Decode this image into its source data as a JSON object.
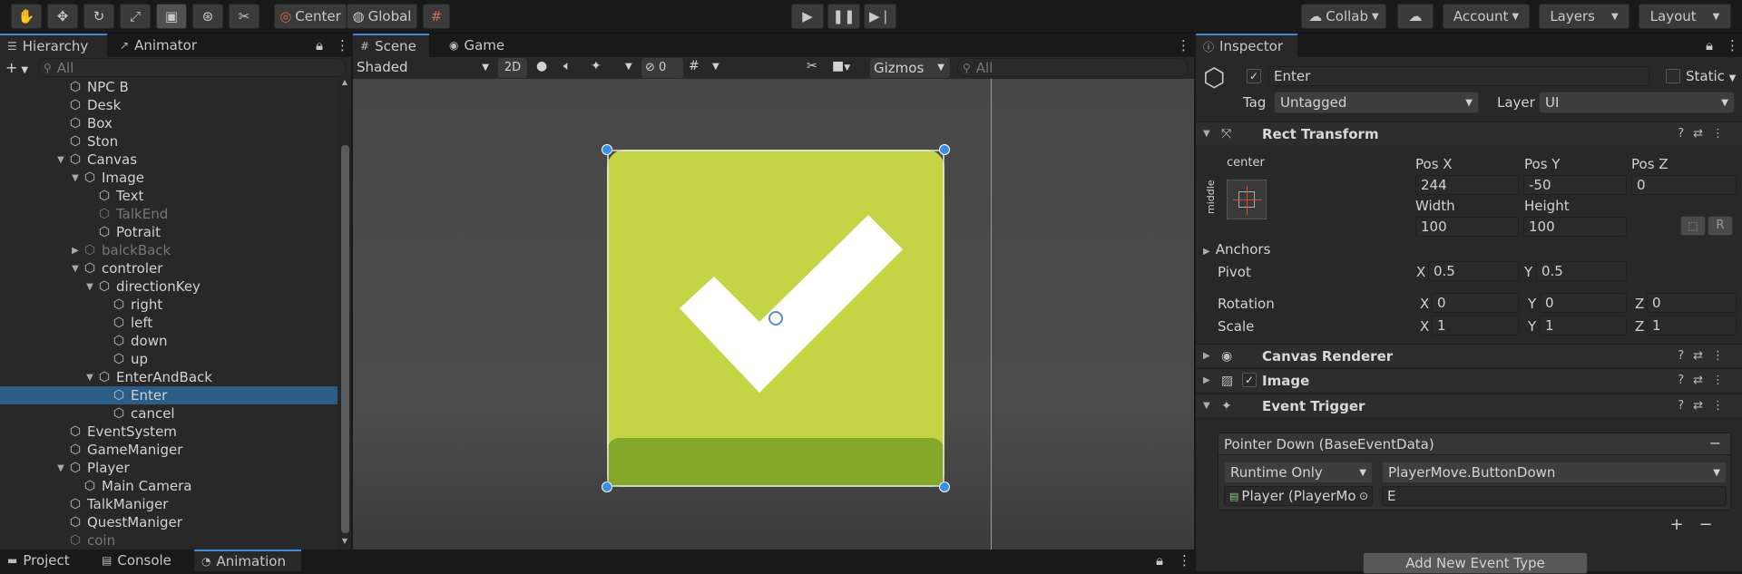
{
  "toolbar": {
    "center_label": "Center",
    "global_label": "Global",
    "collab_label": "Collab",
    "account_label": "Account",
    "layers_label": "Layers",
    "layout_label": "Layout"
  },
  "hierarchy": {
    "tab_label": "Hierarchy",
    "animator_tab_label": "Animator",
    "search_placeholder": "All",
    "items": [
      {
        "label": "NPC B",
        "depth": 2,
        "arrow": "",
        "dim": false,
        "selected": false
      },
      {
        "label": "Desk",
        "depth": 2,
        "arrow": "",
        "dim": false,
        "selected": false
      },
      {
        "label": "Box",
        "depth": 2,
        "arrow": "",
        "dim": false,
        "selected": false
      },
      {
        "label": "Ston",
        "depth": 2,
        "arrow": "",
        "dim": false,
        "selected": false
      },
      {
        "label": "Canvas",
        "depth": 2,
        "arrow": "open",
        "dim": false,
        "selected": false
      },
      {
        "label": "Image",
        "depth": 3,
        "arrow": "open",
        "dim": false,
        "selected": false
      },
      {
        "label": "Text",
        "depth": 4,
        "arrow": "",
        "dim": false,
        "selected": false
      },
      {
        "label": "TalkEnd",
        "depth": 4,
        "arrow": "",
        "dim": true,
        "selected": false
      },
      {
        "label": "Potrait",
        "depth": 4,
        "arrow": "",
        "dim": false,
        "selected": false
      },
      {
        "label": "balckBack",
        "depth": 3,
        "arrow": "closed",
        "dim": true,
        "selected": false
      },
      {
        "label": "controler",
        "depth": 3,
        "arrow": "open",
        "dim": false,
        "selected": false
      },
      {
        "label": "directionKey",
        "depth": 4,
        "arrow": "open",
        "dim": false,
        "selected": false
      },
      {
        "label": "right",
        "depth": 5,
        "arrow": "",
        "dim": false,
        "selected": false
      },
      {
        "label": "left",
        "depth": 5,
        "arrow": "",
        "dim": false,
        "selected": false
      },
      {
        "label": "down",
        "depth": 5,
        "arrow": "",
        "dim": false,
        "selected": false
      },
      {
        "label": "up",
        "depth": 5,
        "arrow": "",
        "dim": false,
        "selected": false
      },
      {
        "label": "EnterAndBack",
        "depth": 4,
        "arrow": "open",
        "dim": false,
        "selected": false
      },
      {
        "label": "Enter",
        "depth": 5,
        "arrow": "",
        "dim": false,
        "selected": true
      },
      {
        "label": "cancel",
        "depth": 5,
        "arrow": "",
        "dim": false,
        "selected": false
      },
      {
        "label": "EventSystem",
        "depth": 2,
        "arrow": "",
        "dim": false,
        "selected": false
      },
      {
        "label": "GameManiger",
        "depth": 2,
        "arrow": "",
        "dim": false,
        "selected": false
      },
      {
        "label": "Player",
        "depth": 2,
        "arrow": "open",
        "dim": false,
        "selected": false
      },
      {
        "label": "Main Camera",
        "depth": 3,
        "arrow": "",
        "dim": false,
        "selected": false
      },
      {
        "label": "TalkManiger",
        "depth": 2,
        "arrow": "",
        "dim": false,
        "selected": false
      },
      {
        "label": "QuestManiger",
        "depth": 2,
        "arrow": "",
        "dim": false,
        "selected": false
      },
      {
        "label": "coin",
        "depth": 2,
        "arrow": "",
        "dim": true,
        "selected": false
      }
    ]
  },
  "bottom_tabs": {
    "project": "Project",
    "console": "Console",
    "animation": "Animation"
  },
  "scene": {
    "scene_tab": "Scene",
    "game_tab": "Game",
    "shading_mode": "Shaded",
    "mode_2d": "2D",
    "hidden_count": "0",
    "gizmos_label": "Gizmos",
    "search_placeholder": "All"
  },
  "inspector": {
    "tab_label": "Inspector",
    "object_name": "Enter",
    "static_label": "Static",
    "tag_label": "Tag",
    "tag_value": "Untagged",
    "layer_label": "Layer",
    "layer_value": "UI",
    "rect_transform": {
      "title": "Rect Transform",
      "anchor_h": "center",
      "anchor_v": "middle",
      "pos_x_label": "Pos X",
      "pos_y_label": "Pos Y",
      "pos_z_label": "Pos Z",
      "pos_x": "244",
      "pos_y": "-50",
      "pos_z": "0",
      "width_label": "Width",
      "height_label": "Height",
      "width": "100",
      "height": "100",
      "r_button": "R",
      "anchors_label": "Anchors",
      "pivot_label": "Pivot",
      "pivot_x": "0.5",
      "pivot_y": "0.5",
      "rotation_label": "Rotation",
      "rot_x": "0",
      "rot_y": "0",
      "rot_z": "0",
      "scale_label": "Scale",
      "scale_x": "1",
      "scale_y": "1",
      "scale_z": "1",
      "x": "X",
      "y": "Y",
      "z": "Z"
    },
    "canvas_renderer_title": "Canvas Renderer",
    "image_title": "Image",
    "event_trigger": {
      "title": "Event Trigger",
      "event_name": "Pointer Down (BaseEventData)",
      "runtime_mode": "Runtime Only",
      "function": "PlayerMove.ButtonDown",
      "target_object": "Player (PlayerMo",
      "argument": "E",
      "plus": "+",
      "minus": "−",
      "remove": "−",
      "add_event_button": "Add New Event Type"
    }
  },
  "colors": {
    "accent_blue": "#3c8cdc",
    "selection": "#2c5d87",
    "button_green": "#c3d444"
  }
}
